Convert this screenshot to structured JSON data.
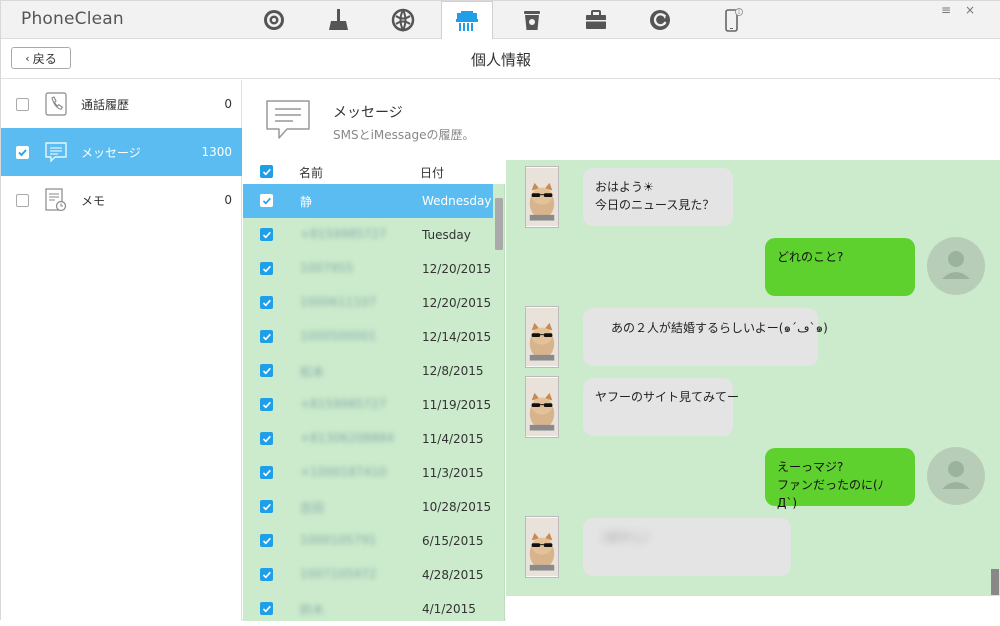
{
  "app": {
    "brand": "PhoneClean"
  },
  "toolbar": {
    "tools": [
      {
        "name": "quick-clean",
        "icon": "target-icon"
      },
      {
        "name": "deep-clean",
        "icon": "broom-icon"
      },
      {
        "name": "internet-clean",
        "icon": "globe-icon"
      },
      {
        "name": "privacy-clean",
        "icon": "shredder-icon",
        "active": true
      },
      {
        "name": "system-clean",
        "icon": "trash-icon"
      },
      {
        "name": "toolbox",
        "icon": "briefcase-icon"
      },
      {
        "name": "backup",
        "icon": "refresh-icon"
      },
      {
        "name": "device",
        "icon": "phone-icon",
        "badge": "1"
      }
    ],
    "window_controls": {
      "menu": "≡",
      "close": "×"
    }
  },
  "subheader": {
    "back_label": "戻る",
    "title": "個人情報"
  },
  "sidebar": {
    "items": [
      {
        "label": "通話履歴",
        "count": "0",
        "checked": false,
        "icon": "phone-log-icon"
      },
      {
        "label": "メッセージ",
        "count": "1300",
        "checked": true,
        "icon": "message-icon"
      },
      {
        "label": "メモ",
        "count": "0",
        "checked": false,
        "icon": "memo-icon"
      }
    ]
  },
  "detail": {
    "title": "メッセージ",
    "subtitle": "SMSとiMessageの履歴。"
  },
  "list": {
    "col_name": "名前",
    "col_date": "日付",
    "rows": [
      {
        "name": "静",
        "date": "Wednesday",
        "selected": true
      },
      {
        "name": "+8159985727",
        "date": "Tuesday"
      },
      {
        "name": "1007955",
        "date": "12/20/2015"
      },
      {
        "name": "1000611107",
        "date": "12/20/2015"
      },
      {
        "name": "1000500001",
        "date": "12/14/2015"
      },
      {
        "name": "松本",
        "date": "12/8/2015"
      },
      {
        "name": "+8159985727",
        "date": "11/19/2015"
      },
      {
        "name": "+81306208884",
        "date": "11/4/2015"
      },
      {
        "name": "+1000187410",
        "date": "11/3/2015"
      },
      {
        "name": "吉田",
        "date": "10/28/2015"
      },
      {
        "name": "1000105791",
        "date": "6/15/2015"
      },
      {
        "name": "1007105972",
        "date": "4/28/2015"
      },
      {
        "name": "鈴木",
        "date": "4/1/2015"
      }
    ]
  },
  "chat": {
    "messages": [
      {
        "dir": "in",
        "lines": [
          "おはよう☀",
          "今日のニュース見た？"
        ]
      },
      {
        "dir": "out",
        "lines": [
          "どれのこと?"
        ]
      },
      {
        "dir": "in",
        "lines": [
          "あの２人が結婚するらしいよー(๑´ڡ`๑)"
        ]
      },
      {
        "dir": "in",
        "lines": [
          "ヤフーのサイト見てみてー"
        ]
      },
      {
        "dir": "out",
        "lines": [
          "えーっマジ?",
          "ファンだったのに(ﾉД`)"
        ]
      },
      {
        "dir": "in",
        "lines": [
          "（ぼかし）"
        ],
        "blurred": true
      }
    ]
  },
  "colors": {
    "selected": "#5bbcf1",
    "list_bg": "#cbebcc",
    "out_bubble": "#5ed12f",
    "in_bubble": "#e4e4e4",
    "checkbox": "#1e9fe8"
  }
}
